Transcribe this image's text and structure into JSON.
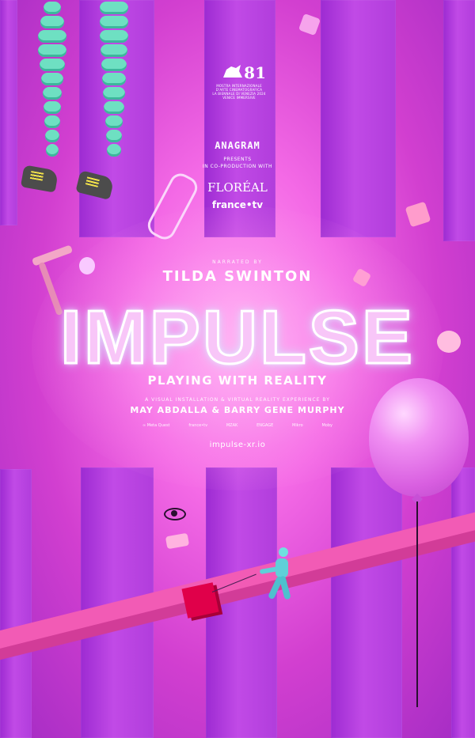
{
  "festival": {
    "number": "81",
    "lines": [
      "MOSTRA INTERNAZIONALE",
      "D'ARTE CINEMATOGRAFICA",
      "LA BIENNALE DI VENEZIA 2024",
      "VENICE IMMERSIVE"
    ]
  },
  "credits": {
    "studio": "ANAGRAM",
    "presents": "PRESENTS",
    "coproduction": "IN CO-PRODUCTION WITH",
    "partner1": "FLORÉAL",
    "partner2": "france•tv",
    "narrated_by": "NARRATED BY",
    "narrator": "TILDA SWINTON"
  },
  "title": "IMPULSE",
  "tagline": "PLAYING WITH REALITY",
  "description": "A VISUAL INSTALLATION & VIRTUAL REALITY EXPERIENCE BY",
  "authors": "MAY ABDALLA & BARRY GENE MURPHY",
  "partners": [
    "∞ Meta Quest",
    "france•tv",
    "MZAK",
    "ENGAGE",
    "Mikro",
    "Moby"
  ],
  "url": "impulse-xr.io",
  "colors": {
    "background": "#e24fd0",
    "pillar": "#b13ddc",
    "title_fill": "#f8c6f8",
    "bead": "#6ee0c2",
    "ramp": "#f25bb5",
    "cube": "#e0004a",
    "balloon": "#d85ee0"
  },
  "icons": [
    "lion-icon",
    "safety-pin-icon",
    "eye-icon",
    "balloon-icon",
    "cube-icon"
  ]
}
